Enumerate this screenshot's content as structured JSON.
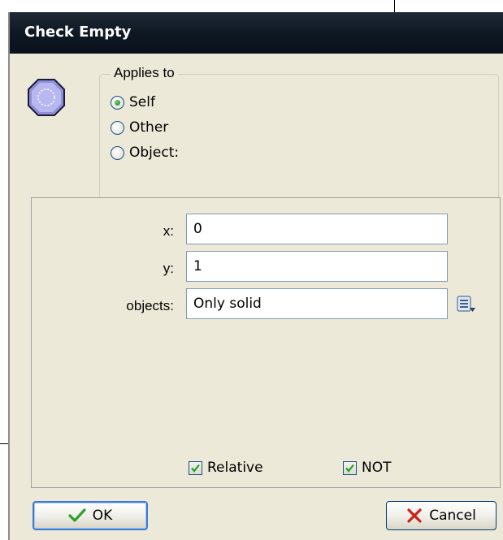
{
  "window": {
    "title": "Check Empty"
  },
  "applies_to": {
    "legend": "Applies to",
    "options": [
      {
        "label": "Self",
        "selected": true
      },
      {
        "label": "Other",
        "selected": false
      },
      {
        "label": "Object:",
        "selected": false
      }
    ]
  },
  "params": {
    "x": {
      "label": "x:",
      "value": "0"
    },
    "y": {
      "label": "y:",
      "value": "1"
    },
    "objects": {
      "label": "objects:",
      "value": "Only solid"
    }
  },
  "checkboxes": {
    "relative": {
      "label": "Relative",
      "checked": true
    },
    "not": {
      "label": "NOT",
      "checked": true
    }
  },
  "buttons": {
    "ok": "OK",
    "cancel": "Cancel"
  },
  "icons": {
    "action": "octagon-icon",
    "menu": "menu-list-icon",
    "ok": "checkmark-icon",
    "cancel": "x-icon"
  },
  "colors": {
    "titlebar": "#0d1722",
    "dialog_bg": "#ece9d8",
    "accent": "#3a7bd5"
  }
}
